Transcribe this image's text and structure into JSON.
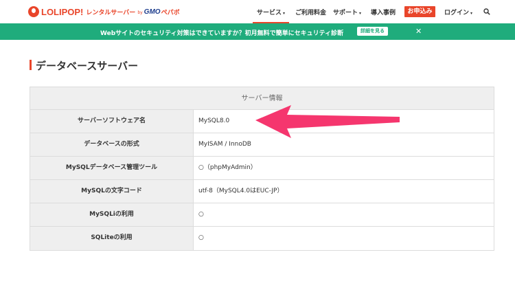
{
  "header": {
    "logo_text": "LOLIPOP!",
    "logo_sub": "レンタルサーバー",
    "logo_by": "by",
    "logo_gmo": "GMO",
    "logo_pepabo": "ペパボ",
    "nav": [
      {
        "label": "サービス",
        "caret": "▾"
      },
      {
        "label": "ご利用料金"
      },
      {
        "label": "サポート",
        "caret": "▾"
      },
      {
        "label": "導入事例"
      },
      {
        "label": "お申込み"
      },
      {
        "label": "ログイン",
        "caret": "▾"
      }
    ]
  },
  "notice": {
    "text": "Webサイトのセキュリティ対策はできていますか？初月無料で簡単にセキュリティ診断",
    "button": "詳細を見る",
    "close": "✕"
  },
  "page": {
    "title": "データベースサーバー"
  },
  "table": {
    "header": "サーバー情報",
    "rows": [
      {
        "label": "サーバーソフトウェア名",
        "value": "MySQL8.0"
      },
      {
        "label": "データベースの形式",
        "value": "MyISAM / InnoDB"
      },
      {
        "label": "MySQLデータベース管理ツール",
        "value": "○（phpMyAdmin）"
      },
      {
        "label": "MySQLの文字コード",
        "value": "utf-8（MySQL4.0はEUC-JP）"
      },
      {
        "label": "MySQLiの利用",
        "value": "○"
      },
      {
        "label": "SQLiteの利用",
        "value": "○"
      }
    ]
  },
  "colors": {
    "brand": "#e9452a",
    "notice_bg": "#1fac7c",
    "arrow": "#f5366e"
  }
}
